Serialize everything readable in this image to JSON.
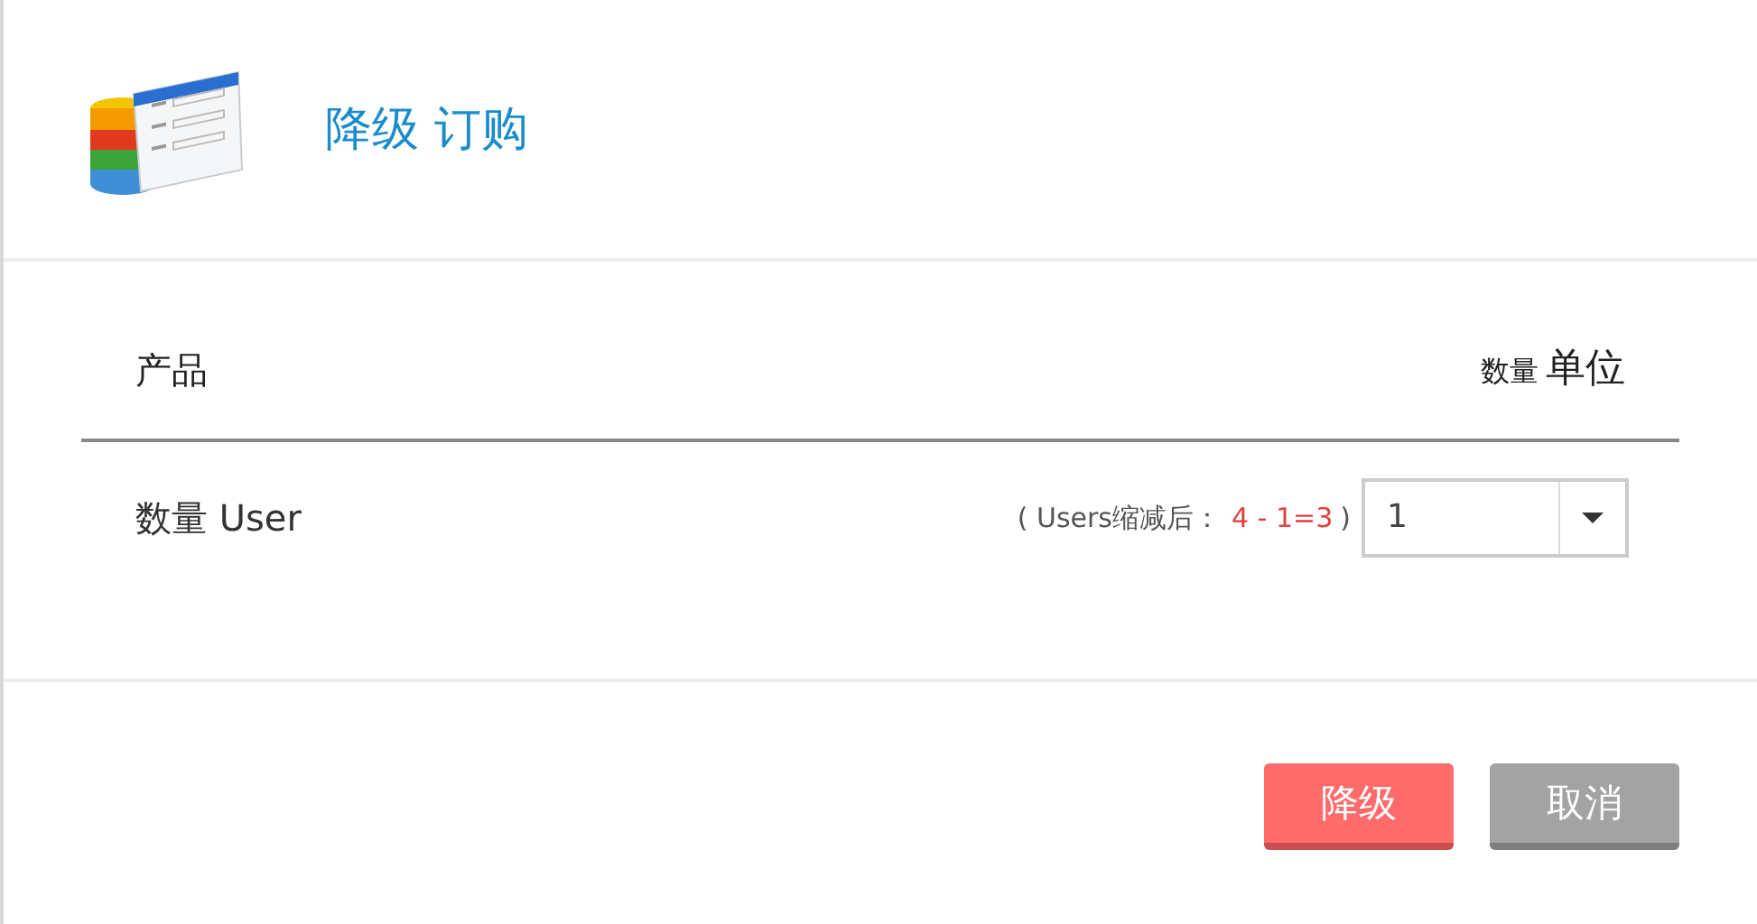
{
  "dialog": {
    "title": "降级 订购"
  },
  "table": {
    "columns": [
      {
        "label": "产品"
      },
      {
        "prefix": "数量",
        "label": "单位"
      }
    ],
    "rows": [
      {
        "product": "数量 User",
        "note_open": "( Users缩减后：",
        "formula": "4 - 1=3",
        "note_close": ")",
        "quantity": "1"
      }
    ]
  },
  "buttons": [
    {
      "label": "降级",
      "kind": "primary"
    },
    {
      "label": "取消",
      "kind": "secondary"
    }
  ]
}
